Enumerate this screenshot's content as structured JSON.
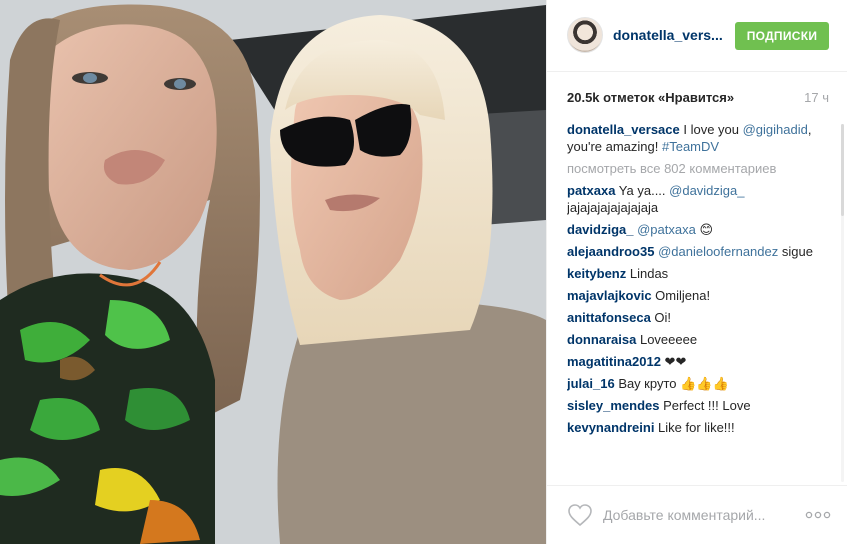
{
  "post": {
    "username": "donatella_vers...",
    "follow_label": "ПОДПИСКИ",
    "likes": "20.5k отметок «Нравится»",
    "time_ago": "17 ч",
    "caption": {
      "user": "donatella_versace",
      "text_1": " I love you ",
      "mention": "@gigihadid",
      "text_2": ", you're amazing! ",
      "hashtag": "#TeamDV"
    },
    "view_all": "посмотреть все 802 комментариев",
    "comments": [
      {
        "user": "patxaxa",
        "mention": "@davidziga_",
        "text_pre": " Ya ya.... ",
        "text_post": " jajajajajajajajaja"
      },
      {
        "user": "davidziga_",
        "mention": "@patxaxa",
        "text_pre": " ",
        "text_post": " 😊"
      },
      {
        "user": "alejaandroo35",
        "mention": "@danieloofernandez",
        "text_pre": " ",
        "text_post": " sigue"
      },
      {
        "user": "keitybenz",
        "mention": "",
        "text_pre": " Lindas",
        "text_post": ""
      },
      {
        "user": "majavlajkovic",
        "mention": "",
        "text_pre": " Omiljena!",
        "text_post": ""
      },
      {
        "user": "anittafonseca",
        "mention": "",
        "text_pre": " Oi!",
        "text_post": ""
      },
      {
        "user": "donnaraisa",
        "mention": "",
        "text_pre": " Loveeeee",
        "text_post": ""
      },
      {
        "user": "magatitina2012",
        "mention": "",
        "text_pre": " ❤❤",
        "text_post": ""
      },
      {
        "user": "julai_16",
        "mention": "",
        "text_pre": " Вау круто 👍👍👍",
        "text_post": ""
      },
      {
        "user": "sisley_mendes",
        "mention": "",
        "text_pre": " Perfect !!! Love",
        "text_post": ""
      },
      {
        "user": "kevynandreini",
        "mention": "",
        "text_pre": " Like for like!!!",
        "text_post": ""
      }
    ],
    "comment_placeholder": "Добавьте комментарий...",
    "icons": {
      "like": "heart-icon",
      "more": "more-options-icon"
    },
    "colors": {
      "follow": "#70c050",
      "username": "#003569",
      "mention": "#3f729b",
      "muted": "#a5a7aa"
    }
  }
}
